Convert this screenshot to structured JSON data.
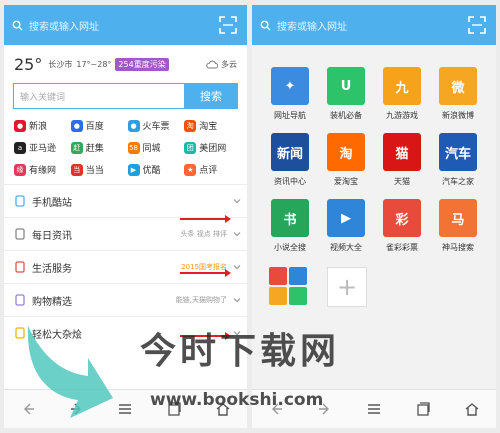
{
  "left": {
    "search_placeholder": "搜索或输入网址",
    "weather": {
      "temp": "25°",
      "city": "长沙市",
      "range": "17°~28°",
      "aqi": "254重度污染",
      "condition": "多云"
    },
    "keyword_placeholder": "输入关键词",
    "search_button": "搜索",
    "links": [
      {
        "label": "新浪",
        "icon": "sina-icon",
        "color": "#e6162d",
        "glyph": "●"
      },
      {
        "label": "百度",
        "icon": "baidu-icon",
        "color": "#2b6de8",
        "glyph": "●"
      },
      {
        "label": "火车票",
        "icon": "train-icon",
        "color": "#2f9ee0",
        "glyph": "●"
      },
      {
        "label": "淘宝",
        "icon": "taobao-icon",
        "color": "#ff5000",
        "glyph": "淘"
      },
      {
        "label": "亚马逊",
        "icon": "amazon-icon",
        "color": "#222222",
        "glyph": "a"
      },
      {
        "label": "赶集",
        "icon": "ganji-icon",
        "color": "#33a85c",
        "glyph": "赶"
      },
      {
        "label": "同城",
        "icon": "tongcheng-icon",
        "color": "#ff7a00",
        "glyph": "58"
      },
      {
        "label": "美团网",
        "icon": "meituan-icon",
        "color": "#20b8a6",
        "glyph": "团"
      },
      {
        "label": "有缘网",
        "icon": "youyuan-icon",
        "color": "#e3385b",
        "glyph": "缘"
      },
      {
        "label": "当当",
        "icon": "dangdang-icon",
        "color": "#e0322b",
        "glyph": "当"
      },
      {
        "label": "优酷",
        "icon": "youku-icon",
        "color": "#1ba1e2",
        "glyph": "▶"
      },
      {
        "label": "点评",
        "icon": "dianping-icon",
        "color": "#ff6633",
        "glyph": "★"
      }
    ],
    "sections": [
      {
        "label": "手机酷站",
        "tag": "",
        "icon": "phone-icon",
        "color": "#4eb0ec"
      },
      {
        "label": "每日资讯",
        "tag": "头条 视点 排评",
        "icon": "news-icon",
        "color": "#888888"
      },
      {
        "label": "生活服务",
        "tag": "2015国考报名",
        "icon": "search-service-icon",
        "color": "#e05050"
      },
      {
        "label": "购物精选",
        "tag": "能链,天猫购物了",
        "icon": "shopping-icon",
        "color": "#9b7fd4"
      },
      {
        "label": "轻松大杂烩",
        "tag": "",
        "icon": "smile-icon",
        "color": "#f0b400"
      }
    ]
  },
  "right": {
    "search_placeholder": "搜索或输入网址",
    "apps": [
      {
        "label": "网址导航",
        "icon": "compass-icon",
        "color": "#3b8be0",
        "glyph": "✦"
      },
      {
        "label": "装机必备",
        "icon": "wandoujia-icon",
        "color": "#2cc36b",
        "glyph": "U"
      },
      {
        "label": "九游游戏",
        "icon": "jiuyou-icon",
        "color": "#f6a21a",
        "glyph": "九"
      },
      {
        "label": "新浪微博",
        "icon": "weibo-icon",
        "color": "#f5a623",
        "glyph": "微"
      },
      {
        "label": "资讯中心",
        "icon": "news-center-icon",
        "color": "#1e4f9c",
        "glyph": "新闻"
      },
      {
        "label": "爱淘宝",
        "icon": "aitaobao-icon",
        "color": "#ff6a00",
        "glyph": "淘"
      },
      {
        "label": "天猫",
        "icon": "tmall-icon",
        "color": "#d91616",
        "glyph": "猫"
      },
      {
        "label": "汽车之家",
        "icon": "autohome-icon",
        "color": "#1f5bb5",
        "glyph": "汽车"
      },
      {
        "label": "小说全搜",
        "icon": "novel-icon",
        "color": "#26a65b",
        "glyph": "书"
      },
      {
        "label": "视频大全",
        "icon": "video-icon",
        "color": "#2f86d8",
        "glyph": "▶"
      },
      {
        "label": "雀彩彩票",
        "icon": "lottery-icon",
        "color": "#e84a3c",
        "glyph": "彩"
      },
      {
        "label": "神马搜索",
        "icon": "shenma-icon",
        "color": "#f37335",
        "glyph": "马"
      }
    ]
  },
  "watermark": {
    "text": "今时下载网",
    "url": "www.bookshi.com"
  }
}
